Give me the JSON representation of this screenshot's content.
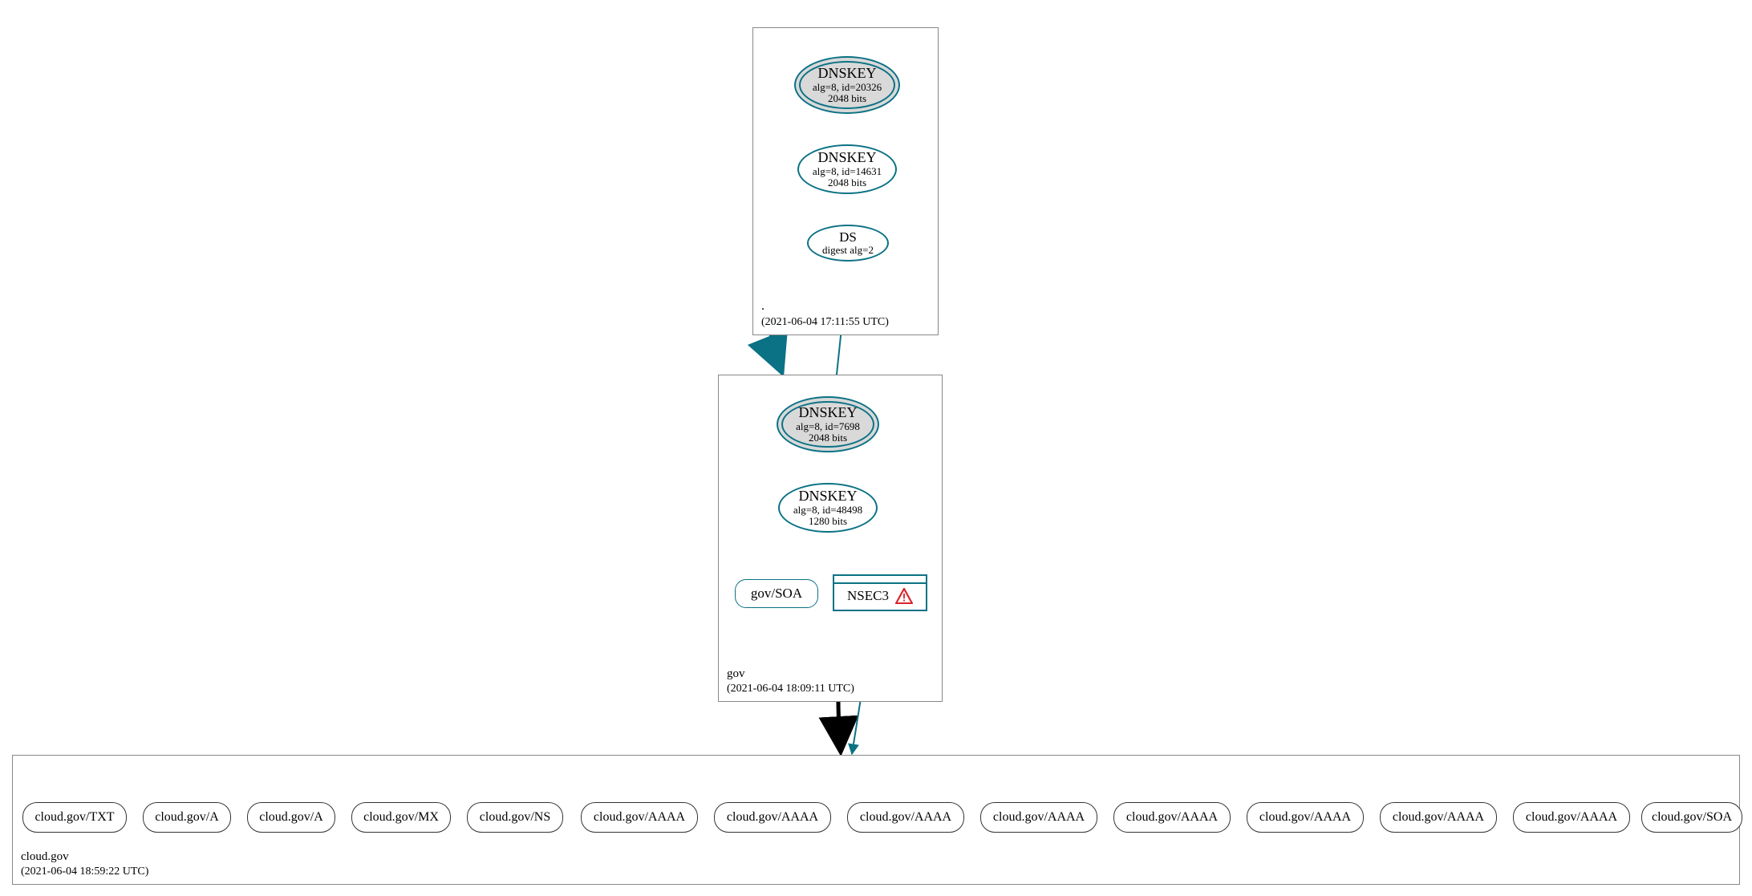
{
  "colors": {
    "teal": "#0b7285",
    "black": "#000000",
    "kskFill": "#d9d9d9",
    "warningRed": "#d9252a"
  },
  "zones": {
    "root": {
      "name": ".",
      "timestamp": "(2021-06-04 17:11:55 UTC)",
      "nodes": {
        "ksk": {
          "title": "DNSKEY",
          "line2": "alg=8, id=20326",
          "line3": "2048 bits",
          "doubleRing": true,
          "fill": "ksk"
        },
        "zsk": {
          "title": "DNSKEY",
          "line2": "alg=8, id=14631",
          "line3": "2048 bits"
        },
        "ds": {
          "title": "DS",
          "line2": "digest alg=2"
        }
      }
    },
    "gov": {
      "name": "gov",
      "timestamp": "(2021-06-04 18:09:11 UTC)",
      "nodes": {
        "ksk": {
          "title": "DNSKEY",
          "line2": "alg=8, id=7698",
          "line3": "2048 bits",
          "doubleRing": true,
          "fill": "ksk"
        },
        "zsk": {
          "title": "DNSKEY",
          "line2": "alg=8, id=48498",
          "line3": "1280 bits"
        },
        "soa": {
          "text": "gov/SOA"
        },
        "nsec": {
          "text": "NSEC3",
          "warning": true
        }
      }
    },
    "cloud": {
      "name": "cloud.gov",
      "timestamp": "(2021-06-04 18:59:22 UTC)",
      "records": [
        "cloud.gov/TXT",
        "cloud.gov/A",
        "cloud.gov/A",
        "cloud.gov/MX",
        "cloud.gov/NS",
        "cloud.gov/AAAA",
        "cloud.gov/AAAA",
        "cloud.gov/AAAA",
        "cloud.gov/AAAA",
        "cloud.gov/AAAA",
        "cloud.gov/AAAA",
        "cloud.gov/AAAA",
        "cloud.gov/AAAA",
        "cloud.gov/SOA"
      ]
    }
  }
}
